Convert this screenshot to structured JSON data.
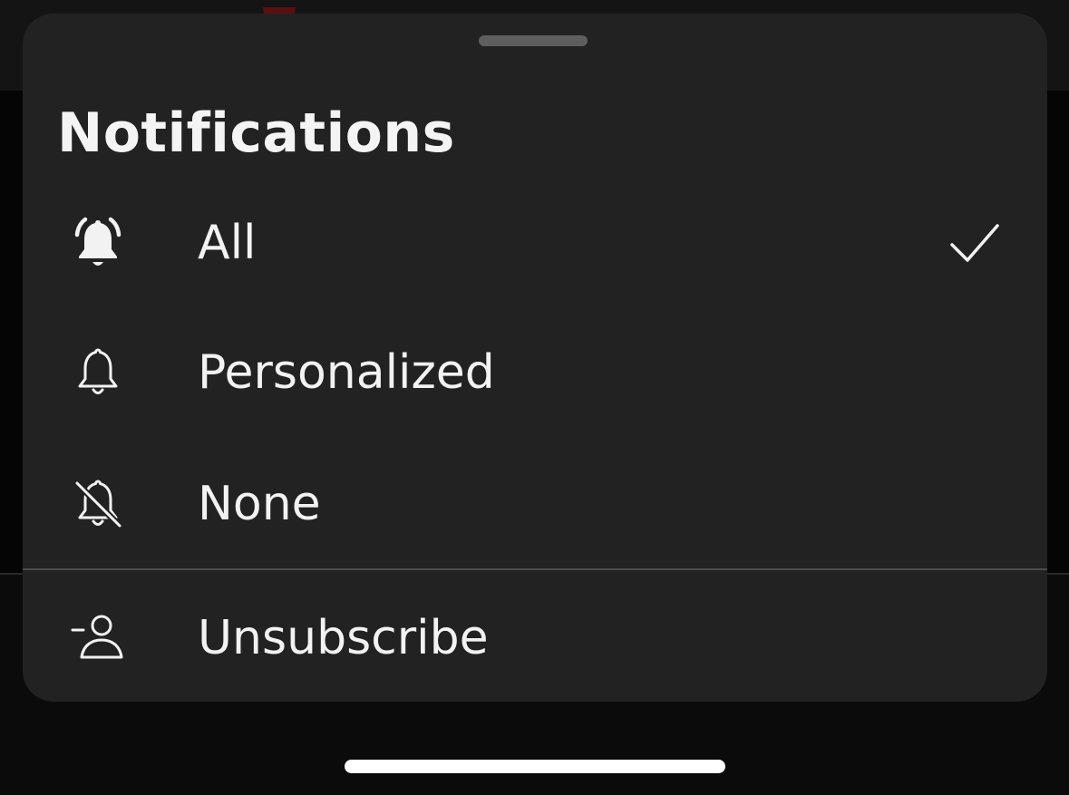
{
  "sheet": {
    "title": "Notifications",
    "options": [
      {
        "label": "All",
        "icon": "bell-ringing-icon",
        "selected": true
      },
      {
        "label": "Personalized",
        "icon": "bell-outline-icon",
        "selected": false
      },
      {
        "label": "None",
        "icon": "bell-off-icon",
        "selected": false
      }
    ],
    "unsubscribe": {
      "label": "Unsubscribe",
      "icon": "person-minus-icon"
    }
  },
  "colors": {
    "sheet_background": "#222222",
    "text": "#f2f2f2",
    "handle": "#5e5e5e",
    "divider": "#4a4a4a"
  }
}
